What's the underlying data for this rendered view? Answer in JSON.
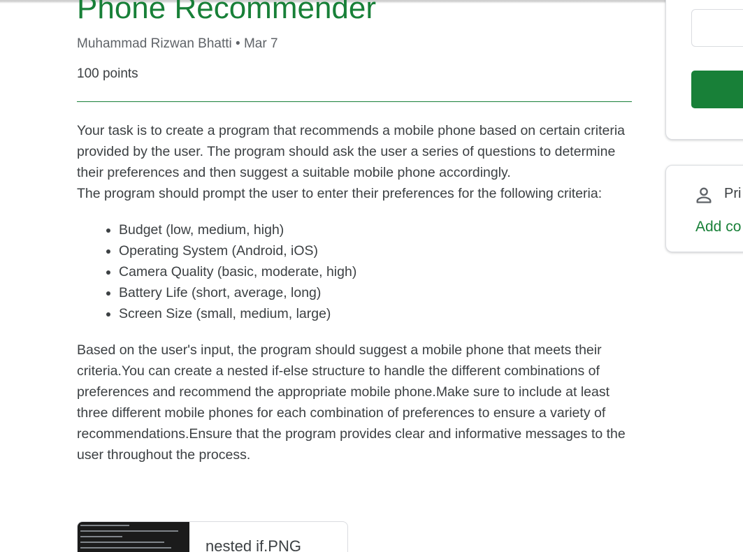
{
  "assignment": {
    "title": "Phone Recommender",
    "author": "Muhammad Rizwan Bhatti",
    "date": "Mar 7",
    "separator": "•",
    "points": "100 points"
  },
  "description": {
    "intro": "Your task is to create a program that recommends a mobile phone based on certain criteria provided by the user. The program should ask the user a series of questions to determine their preferences and then suggest a suitable mobile phone accordingly.",
    "prompt": "The program should prompt the user to enter their preferences for the following criteria:",
    "criteria": [
      "Budget (low, medium, high)",
      "Operating System (Android, iOS)",
      "Camera Quality (basic, moderate, high)",
      "Battery Life (short, average, long)",
      "Screen Size (small, medium, large)"
    ],
    "closing": "Based on the user's input, the program should suggest a mobile phone that meets their criteria.You can create a nested if-else structure to handle the different combinations of preferences and recommend the appropriate mobile phone.Make sure to include at least three different mobile phones for each combination of preferences to ensure a variety of recommendations.Ensure that the program provides clear and informative messages to the user throughout the process."
  },
  "attachment": {
    "filename": "nested if.PNG"
  },
  "side_panel": {
    "private_comments_label": "Pri",
    "add_comment_label": "Add co"
  },
  "colors": {
    "accent": "#188038",
    "text": "#3c4043",
    "muted": "#5f6368",
    "border": "#dadce0"
  },
  "icons": [
    "person-icon"
  ]
}
